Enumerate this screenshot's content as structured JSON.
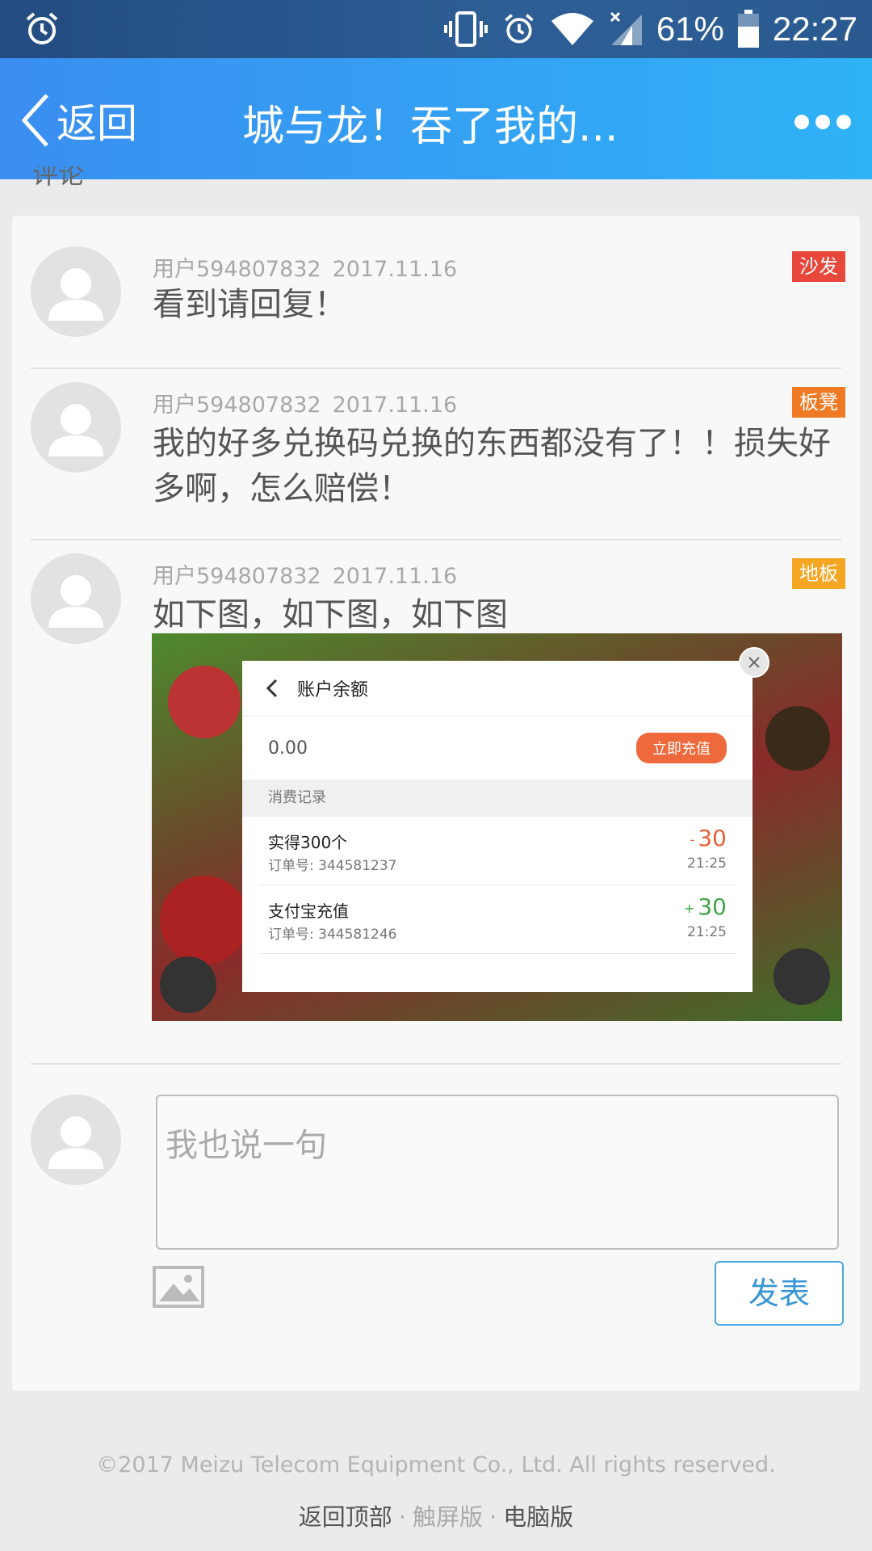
{
  "status_bar": {
    "battery": "61%",
    "time": "22:27"
  },
  "header": {
    "back_label": "返回",
    "title": "城与龙！吞了我的...",
    "more_icon": "more-dots-icon"
  },
  "section_peek": "评论",
  "comments": [
    {
      "user": "用户594807832",
      "date": "2017.11.16",
      "badge": "沙发",
      "badge_color": "#e8483b",
      "text": "看到请回复！"
    },
    {
      "user": "用户594807832",
      "date": "2017.11.16",
      "badge": "板凳",
      "badge_color": "#f07a24",
      "text": "我的好多兑换码兑换的东西都没有了！！损失好多啊，怎么赔偿！"
    },
    {
      "user": "用户594807832",
      "date": "2017.11.16",
      "badge": "地板",
      "badge_color": "#f5a623",
      "text": "如下图，如下图，如下图"
    }
  ],
  "screenshot": {
    "dialog_title": "账户余额",
    "balance": "0.00",
    "charge_button": "立即充值",
    "section_label": "消费记录",
    "records": [
      {
        "name": "实得300个",
        "order": "订单号: 344581237",
        "sign": "-",
        "amount": "30",
        "time": "21:25",
        "color": "#e8623a"
      },
      {
        "name": "支付宝充值",
        "order": "订单号: 344581246",
        "sign": "+",
        "amount": "30",
        "time": "21:25",
        "color": "#3fa84a"
      }
    ]
  },
  "reply": {
    "placeholder": "我也说一句",
    "post_label": "发表"
  },
  "footer": {
    "copyright": "©2017 Meizu Telecom Equipment Co., Ltd. All rights reserved.",
    "back_to_top": "返回顶部",
    "touch_version": "触屏版",
    "pc_version": "电脑版"
  }
}
